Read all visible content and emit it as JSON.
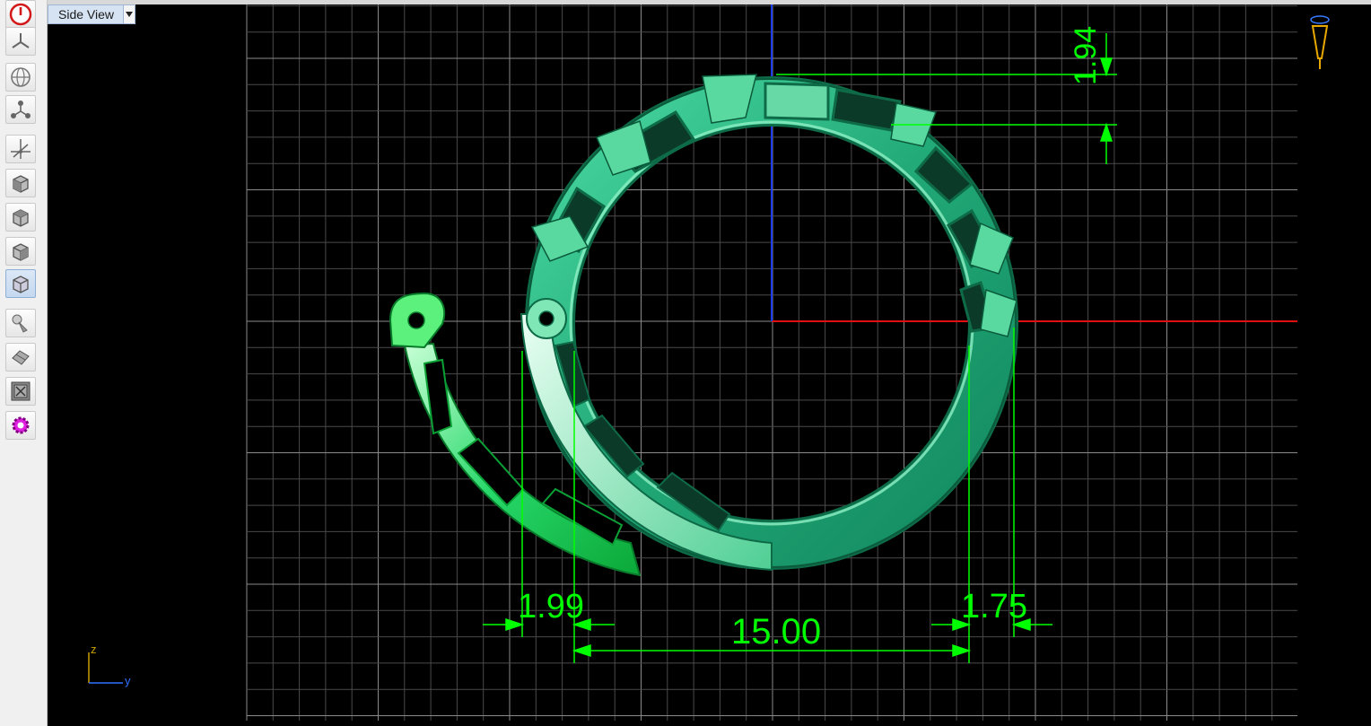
{
  "viewport": {
    "view_name": "Side View",
    "axes": {
      "vertical": "z",
      "horizontal": "y"
    }
  },
  "dimensions": [
    {
      "id": "top-height",
      "value": "1.94"
    },
    {
      "id": "left-width",
      "value": "1.99"
    },
    {
      "id": "inner-diameter",
      "value": "15.00"
    },
    {
      "id": "right-width",
      "value": "1.75"
    }
  ],
  "toolbar": {
    "buttons": [
      {
        "name": "power-button",
        "icon": "power-icon",
        "active": false
      },
      {
        "name": "rotate-tool-button",
        "icon": "tripod-icon",
        "active": false
      },
      {
        "name": "globe-view-button",
        "icon": "globe-icon",
        "active": false
      },
      {
        "name": "pan-tool-button",
        "icon": "pivot-icon",
        "active": false
      },
      {
        "name": "axis-tool-button",
        "icon": "axes-icon",
        "active": false
      },
      {
        "name": "front-view-button",
        "icon": "cube-front-icon",
        "active": false
      },
      {
        "name": "top-view-button",
        "icon": "cube-top-icon",
        "active": false
      },
      {
        "name": "right-view-button",
        "icon": "cube-right-icon",
        "active": false
      },
      {
        "name": "side-view-button",
        "icon": "cube-side-icon",
        "active": true
      },
      {
        "name": "render-button",
        "icon": "render-icon",
        "active": false
      },
      {
        "name": "material-button",
        "icon": "material-icon",
        "active": false
      },
      {
        "name": "zoom-fit-button",
        "icon": "zoom-extents-icon",
        "active": false
      },
      {
        "name": "settings-button",
        "icon": "gear-icon",
        "active": false
      }
    ]
  },
  "colors": {
    "dimension": "#00ff00",
    "ring": "#2fbf8a",
    "ring_highlight": "#9ff5c9",
    "grid": "#5a5a5a",
    "axis_horizontal": "#ff2020",
    "axis_vertical": "#2050ff"
  }
}
